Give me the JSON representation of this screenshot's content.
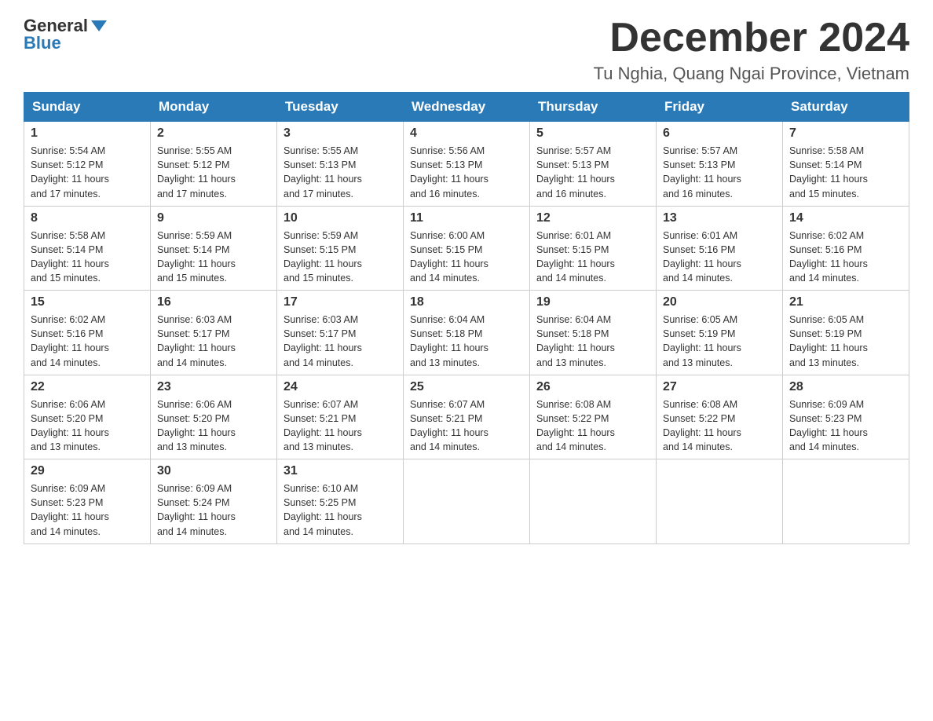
{
  "logo": {
    "general": "General",
    "blue": "Blue"
  },
  "header": {
    "month_title": "December 2024",
    "location": "Tu Nghia, Quang Ngai Province, Vietnam"
  },
  "weekdays": [
    "Sunday",
    "Monday",
    "Tuesday",
    "Wednesday",
    "Thursday",
    "Friday",
    "Saturday"
  ],
  "weeks": [
    [
      {
        "day": "1",
        "sunrise": "5:54 AM",
        "sunset": "5:12 PM",
        "daylight": "11 hours and 17 minutes."
      },
      {
        "day": "2",
        "sunrise": "5:55 AM",
        "sunset": "5:12 PM",
        "daylight": "11 hours and 17 minutes."
      },
      {
        "day": "3",
        "sunrise": "5:55 AM",
        "sunset": "5:13 PM",
        "daylight": "11 hours and 17 minutes."
      },
      {
        "day": "4",
        "sunrise": "5:56 AM",
        "sunset": "5:13 PM",
        "daylight": "11 hours and 16 minutes."
      },
      {
        "day": "5",
        "sunrise": "5:57 AM",
        "sunset": "5:13 PM",
        "daylight": "11 hours and 16 minutes."
      },
      {
        "day": "6",
        "sunrise": "5:57 AM",
        "sunset": "5:13 PM",
        "daylight": "11 hours and 16 minutes."
      },
      {
        "day": "7",
        "sunrise": "5:58 AM",
        "sunset": "5:14 PM",
        "daylight": "11 hours and 15 minutes."
      }
    ],
    [
      {
        "day": "8",
        "sunrise": "5:58 AM",
        "sunset": "5:14 PM",
        "daylight": "11 hours and 15 minutes."
      },
      {
        "day": "9",
        "sunrise": "5:59 AM",
        "sunset": "5:14 PM",
        "daylight": "11 hours and 15 minutes."
      },
      {
        "day": "10",
        "sunrise": "5:59 AM",
        "sunset": "5:15 PM",
        "daylight": "11 hours and 15 minutes."
      },
      {
        "day": "11",
        "sunrise": "6:00 AM",
        "sunset": "5:15 PM",
        "daylight": "11 hours and 14 minutes."
      },
      {
        "day": "12",
        "sunrise": "6:01 AM",
        "sunset": "5:15 PM",
        "daylight": "11 hours and 14 minutes."
      },
      {
        "day": "13",
        "sunrise": "6:01 AM",
        "sunset": "5:16 PM",
        "daylight": "11 hours and 14 minutes."
      },
      {
        "day": "14",
        "sunrise": "6:02 AM",
        "sunset": "5:16 PM",
        "daylight": "11 hours and 14 minutes."
      }
    ],
    [
      {
        "day": "15",
        "sunrise": "6:02 AM",
        "sunset": "5:16 PM",
        "daylight": "11 hours and 14 minutes."
      },
      {
        "day": "16",
        "sunrise": "6:03 AM",
        "sunset": "5:17 PM",
        "daylight": "11 hours and 14 minutes."
      },
      {
        "day": "17",
        "sunrise": "6:03 AM",
        "sunset": "5:17 PM",
        "daylight": "11 hours and 14 minutes."
      },
      {
        "day": "18",
        "sunrise": "6:04 AM",
        "sunset": "5:18 PM",
        "daylight": "11 hours and 13 minutes."
      },
      {
        "day": "19",
        "sunrise": "6:04 AM",
        "sunset": "5:18 PM",
        "daylight": "11 hours and 13 minutes."
      },
      {
        "day": "20",
        "sunrise": "6:05 AM",
        "sunset": "5:19 PM",
        "daylight": "11 hours and 13 minutes."
      },
      {
        "day": "21",
        "sunrise": "6:05 AM",
        "sunset": "5:19 PM",
        "daylight": "11 hours and 13 minutes."
      }
    ],
    [
      {
        "day": "22",
        "sunrise": "6:06 AM",
        "sunset": "5:20 PM",
        "daylight": "11 hours and 13 minutes."
      },
      {
        "day": "23",
        "sunrise": "6:06 AM",
        "sunset": "5:20 PM",
        "daylight": "11 hours and 13 minutes."
      },
      {
        "day": "24",
        "sunrise": "6:07 AM",
        "sunset": "5:21 PM",
        "daylight": "11 hours and 13 minutes."
      },
      {
        "day": "25",
        "sunrise": "6:07 AM",
        "sunset": "5:21 PM",
        "daylight": "11 hours and 14 minutes."
      },
      {
        "day": "26",
        "sunrise": "6:08 AM",
        "sunset": "5:22 PM",
        "daylight": "11 hours and 14 minutes."
      },
      {
        "day": "27",
        "sunrise": "6:08 AM",
        "sunset": "5:22 PM",
        "daylight": "11 hours and 14 minutes."
      },
      {
        "day": "28",
        "sunrise": "6:09 AM",
        "sunset": "5:23 PM",
        "daylight": "11 hours and 14 minutes."
      }
    ],
    [
      {
        "day": "29",
        "sunrise": "6:09 AM",
        "sunset": "5:23 PM",
        "daylight": "11 hours and 14 minutes."
      },
      {
        "day": "30",
        "sunrise": "6:09 AM",
        "sunset": "5:24 PM",
        "daylight": "11 hours and 14 minutes."
      },
      {
        "day": "31",
        "sunrise": "6:10 AM",
        "sunset": "5:25 PM",
        "daylight": "11 hours and 14 minutes."
      },
      null,
      null,
      null,
      null
    ]
  ]
}
